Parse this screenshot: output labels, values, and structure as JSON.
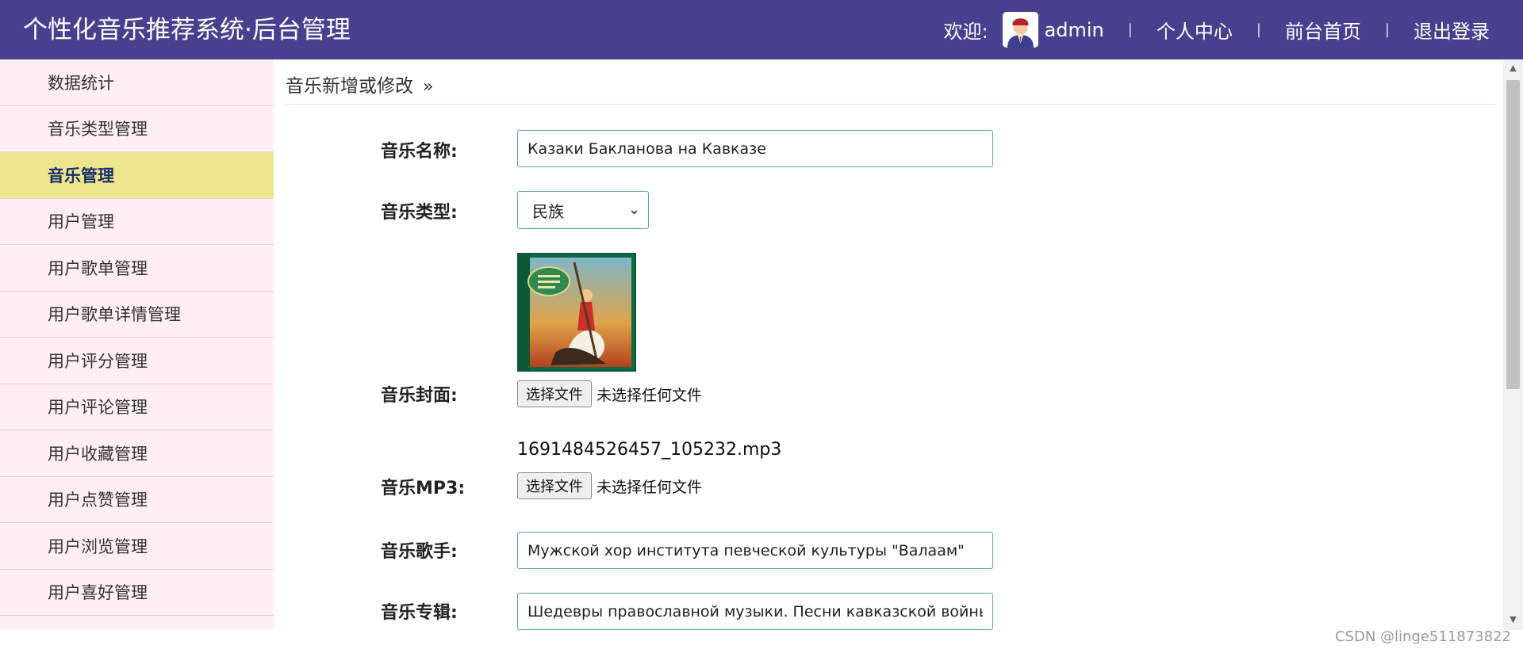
{
  "header": {
    "title": "个性化音乐推荐系统·后台管理",
    "welcome": "欢迎:",
    "username": "admin",
    "separator": "|",
    "links": [
      "个人中心",
      "前台首页",
      "退出登录"
    ]
  },
  "sidebar": {
    "items": [
      {
        "label": "数据统计"
      },
      {
        "label": "音乐类型管理"
      },
      {
        "label": "音乐管理",
        "active": true
      },
      {
        "label": "用户管理"
      },
      {
        "label": "用户歌单管理"
      },
      {
        "label": "用户歌单详情管理"
      },
      {
        "label": "用户评分管理"
      },
      {
        "label": "用户评论管理"
      },
      {
        "label": "用户收藏管理"
      },
      {
        "label": "用户点赞管理"
      },
      {
        "label": "用户浏览管理"
      },
      {
        "label": "用户喜好管理"
      }
    ]
  },
  "breadcrumb": {
    "text": "音乐新增或修改",
    "chevron": "»"
  },
  "form": {
    "name_label": "音乐名称:",
    "name_value": "Казаки Бакланова на Кавказе",
    "type_label": "音乐类型:",
    "type_selected": "民族",
    "cover_label": "音乐封面:",
    "cover_button": "选择文件",
    "cover_status": "未选择任何文件",
    "mp3_label": "音乐MP3:",
    "mp3_filename": "1691484526457_105232.mp3",
    "mp3_button": "选择文件",
    "mp3_status": "未选择任何文件",
    "singer_label": "音乐歌手:",
    "singer_value": "Мужской хор института певческой культуры \"Валаам\"",
    "album_label": "音乐专辑:",
    "album_value": "Шедевры православной музыки. Песни кавказской войны"
  },
  "watermark": "CSDN @linge511873822",
  "colors": {
    "header_bg": "#493f8f",
    "sidebar_bg": "#ffeef3",
    "active_bg": "#ede68f",
    "input_border": "#5aa6a6"
  }
}
